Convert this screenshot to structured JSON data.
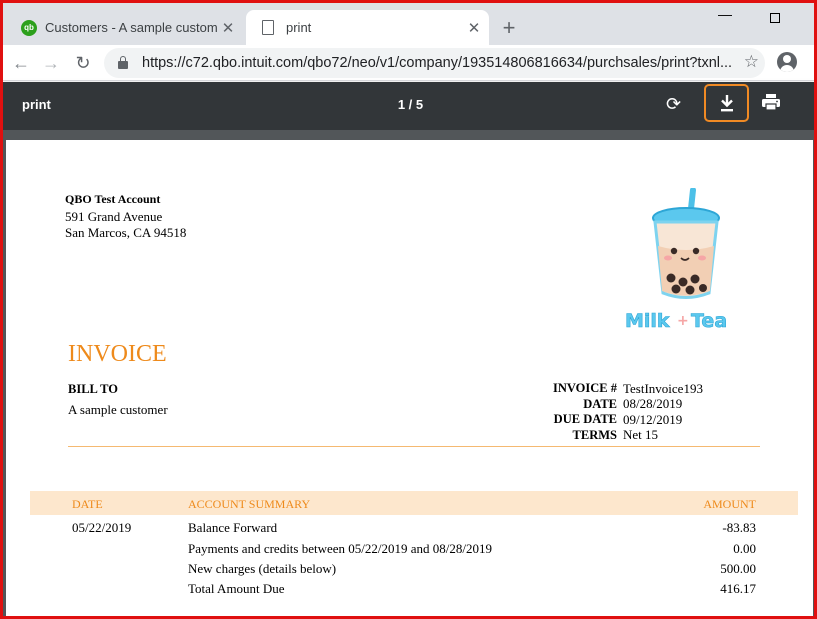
{
  "browser": {
    "tabs": [
      {
        "title": "Customers - A sample customer",
        "icon": "quickbooks-icon",
        "active": false
      },
      {
        "title": "print",
        "icon": "document-icon",
        "active": true
      }
    ],
    "url": "https://c72.qbo.intuit.com/qbo72/neo/v1/company/193514806816634/purchsales/print?txnl..."
  },
  "pdf_viewer": {
    "title": "print",
    "page_indicator": "1  /  5",
    "highlight_color": "#f08a24"
  },
  "invoice": {
    "company": {
      "name": "QBO Test Account",
      "address_line1": "591 Grand Avenue",
      "address_line2": "San Marcos, CA  94518"
    },
    "logo_text": {
      "word1": "Milk",
      "plus": "+",
      "word2": "Tea"
    },
    "heading": "INVOICE",
    "bill_to_label": "BILL TO",
    "customer": "A sample customer",
    "meta": [
      {
        "label": "INVOICE #",
        "value": "TestInvoice193"
      },
      {
        "label": "DATE",
        "value": "08/28/2019"
      },
      {
        "label": "DUE DATE",
        "value": "09/12/2019"
      },
      {
        "label": "TERMS",
        "value": "Net 15"
      }
    ],
    "accent_color": "#ee8a1b",
    "table": {
      "headers": {
        "date": "DATE",
        "summary": "ACCOUNT SUMMARY",
        "amount": "AMOUNT"
      },
      "rows": [
        {
          "date": "05/22/2019",
          "summary": "Balance Forward",
          "amount": "-83.83"
        },
        {
          "date": "",
          "summary": "Payments and credits between 05/22/2019 and 08/28/2019",
          "amount": "0.00"
        },
        {
          "date": "",
          "summary": "New charges (details below)",
          "amount": "500.00"
        },
        {
          "date": "",
          "summary": "Total Amount Due",
          "amount": "416.17"
        }
      ]
    }
  }
}
